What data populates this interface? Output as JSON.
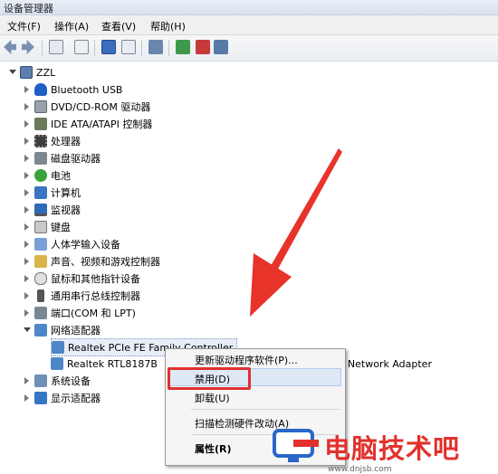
{
  "window": {
    "title": "设备管理器"
  },
  "menu": [
    {
      "label": "文件(F)",
      "name": "menu-file"
    },
    {
      "label": "操作(A)",
      "name": "menu-action"
    },
    {
      "label": "查看(V)",
      "name": "menu-view"
    },
    {
      "label": "帮助(H)",
      "name": "menu-help"
    }
  ],
  "tree": {
    "root": "ZZL",
    "categories": [
      "Bluetooth USB",
      "DVD/CD-ROM 驱动器",
      "IDE ATA/ATAPI 控制器",
      "处理器",
      "磁盘驱动器",
      "电池",
      "计算机",
      "监视器",
      "键盘",
      "人体学输入设备",
      "声音、视频和游戏控制器",
      "鼠标和其他指针设备",
      "通用串行总线控制器",
      "端口(COM 和 LPT)",
      "网络适配器",
      "系统设备",
      "显示适配器"
    ],
    "network_children": [
      "Realtek PCIe FE Family Controller",
      "Realtek RTL8187B Wireless 802.11b/g 54Mbps USB 2.0 Network Adapter"
    ],
    "adapter_visible_prefix": "Realtek RTL8187B",
    "adapter_visible_suffix": "Network Adapter"
  },
  "context_menu": {
    "update": "更新驱动程序软件(P)...",
    "disable": "禁用(D)",
    "uninstall": "卸载(U)",
    "scan": "扫描检测硬件改动(A)",
    "properties": "属性(R)"
  },
  "watermark": {
    "brand": "电脑技术吧",
    "url": "www.dnjsb.com"
  },
  "colors": {
    "arrow": "#e8332b",
    "highlight_box": "#e03030",
    "brand": "#e2312c"
  }
}
